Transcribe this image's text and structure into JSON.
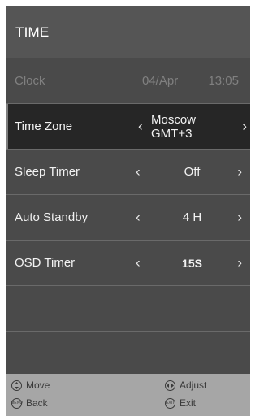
{
  "header": {
    "title": "TIME"
  },
  "rows": {
    "clock": {
      "label": "Clock",
      "date": "04/Apr",
      "time": "13:05"
    },
    "time_zone": {
      "label": "Time Zone",
      "value": "Moscow GMT+3"
    },
    "sleep_timer": {
      "label": "Sleep Timer",
      "value": "Off"
    },
    "auto_standby": {
      "label": "Auto Standby",
      "value": "4 H"
    },
    "osd_timer": {
      "label": "OSD Timer",
      "value": "15S"
    }
  },
  "arrows": {
    "left": "‹",
    "right": "›"
  },
  "footer": {
    "move": "Move",
    "adjust": "Adjust",
    "back": "Back",
    "exit": "Exit",
    "menu_icon_text": "MENU",
    "exit_icon_text": "EXIT"
  },
  "colors": {
    "panel": "#4a4a4a",
    "selected": "#262626",
    "footer": "#a6a6a6"
  }
}
